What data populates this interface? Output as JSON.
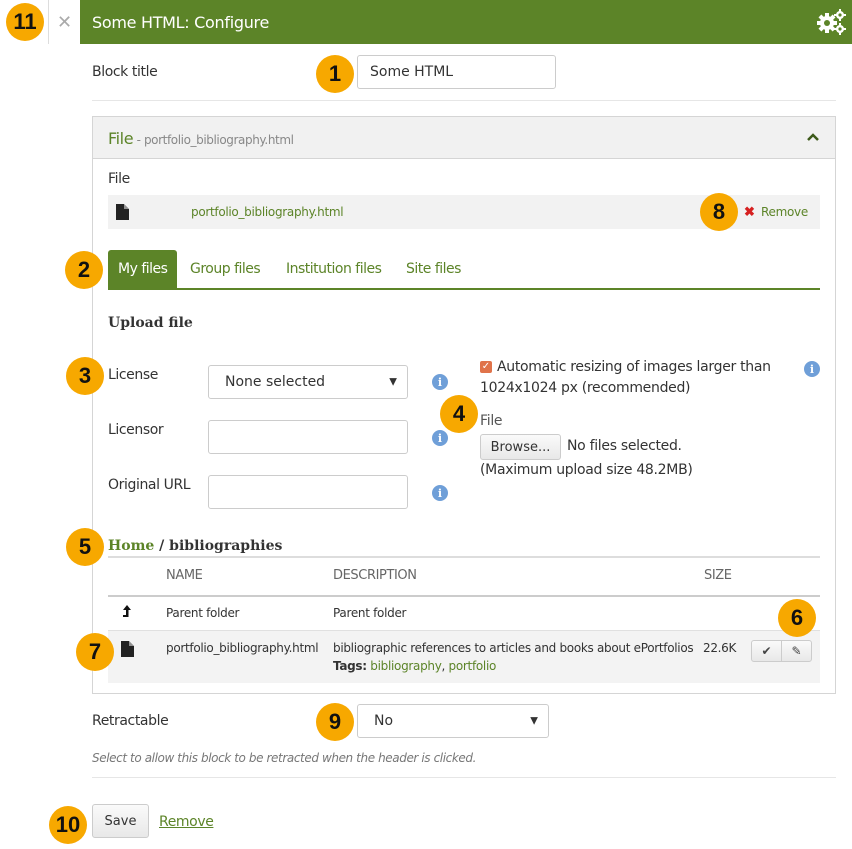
{
  "header": {
    "title": "Some HTML: Configure",
    "close_icon": "close-icon",
    "settings_icon": "gears-icon",
    "bg_color": "#5c8428"
  },
  "badges": [
    "1",
    "2",
    "3",
    "4",
    "5",
    "6",
    "7",
    "8",
    "9",
    "10",
    "11"
  ],
  "block_title": {
    "label": "Block title",
    "value": "Some HTML"
  },
  "file_panel": {
    "title": "File",
    "subtitle": " - portfolio_bibliography.html",
    "chevron": "^",
    "file_label": "File",
    "selected_file": "portfolio_bibliography.html",
    "remove_icon": "✖",
    "remove_label": "Remove"
  },
  "tabs": [
    {
      "label": "My files",
      "active": true
    },
    {
      "label": "Group files",
      "active": false
    },
    {
      "label": "Institution files",
      "active": false
    },
    {
      "label": "Site files",
      "active": false
    }
  ],
  "upload": {
    "title": "Upload file",
    "license_label": "License",
    "license_value": "None selected",
    "licensor_label": "Licensor",
    "licensor_value": "",
    "original_url_label": "Original URL",
    "original_url_value": "",
    "resize_checked": true,
    "resize_text_1": "Automatic resizing of images larger than",
    "resize_text_2": "1024x1024 px (recommended)",
    "file_label": "File",
    "browse_label": "Browse...",
    "no_files": "No files selected.",
    "max_size": "(Maximum upload size 48.2MB)"
  },
  "browser": {
    "breadcrumb_home": "Home",
    "breadcrumb_sep": " / ",
    "breadcrumb_current": "bibliographies",
    "columns": [
      "NAME",
      "DESCRIPTION",
      "SIZE"
    ],
    "rows": [
      {
        "icon": "parent-folder-icon",
        "name": "Parent folder",
        "description": "Parent folder",
        "size": ""
      },
      {
        "icon": "file-icon",
        "name": "portfolio_bibliography.html",
        "description": "bibliographic references to articles and books about ePortfolios",
        "size": "22.6K",
        "tags_label": "Tags:",
        "tags": [
          "bibliography",
          "portfolio"
        ]
      }
    ]
  },
  "retractable": {
    "label": "Retractable",
    "value": "No",
    "help": "Select to allow this block to be retracted when the header is clicked."
  },
  "footer": {
    "save_label": "Save",
    "remove_label": "Remove"
  }
}
